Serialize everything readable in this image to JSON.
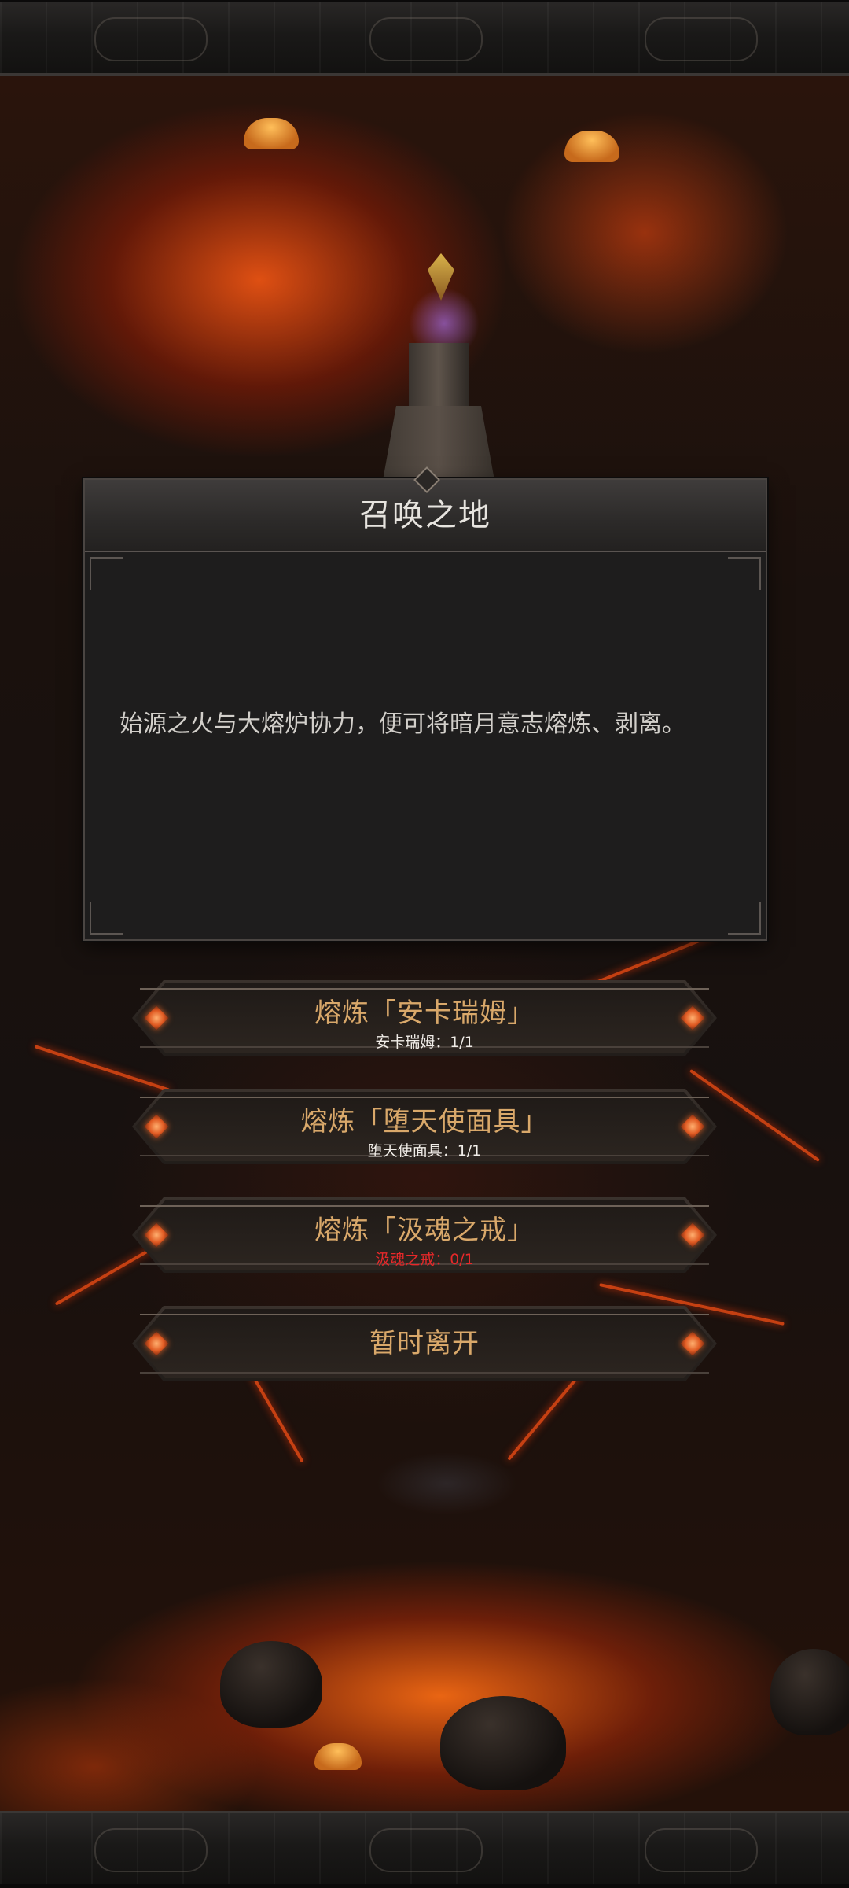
{
  "dialog": {
    "title": "召唤之地",
    "body": "始源之火与大熔炉协力，便可将暗月意志熔炼、剥离。"
  },
  "options": [
    {
      "label": "熔炼「安卡瑞姆」",
      "requirement": "安卡瑞姆：1/1",
      "status": "met"
    },
    {
      "label": "熔炼「堕天使面具」",
      "requirement": "堕天使面具：1/1",
      "status": "met"
    },
    {
      "label": "熔炼「汲魂之戒」",
      "requirement": "汲魂之戒：0/1",
      "status": "missing"
    },
    {
      "label": "暂时离开"
    }
  ],
  "colors": {
    "option_label": "#d9a86a",
    "requirement_met": "#f1ede8",
    "requirement_missing": "#e8282a",
    "gem": "#e05a22"
  }
}
